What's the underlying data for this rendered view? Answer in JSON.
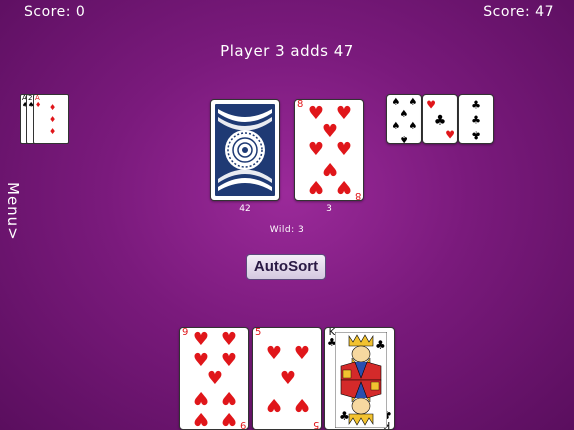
{
  "scores": {
    "left": "Score: 0",
    "right": "Score: 47"
  },
  "message": "Player 3 adds 47",
  "piles": {
    "draw_count": "42",
    "discard_count": "3"
  },
  "wild": "Wild: 3",
  "buttons": {
    "autosort": "AutoSort",
    "menu": "Menu>"
  },
  "colors": {
    "background": "#7a1a7c",
    "red_suit": "#e0161a",
    "black_suit": "#000000",
    "button_text": "#2a1a44"
  },
  "cards": {
    "opponent_left": [
      {
        "rank": "A",
        "suit": "spades"
      },
      {
        "rank": "2",
        "suit": "spades"
      },
      {
        "rank": "A",
        "suit": "diamonds",
        "pips": 3
      }
    ],
    "discard_top": {
      "rank": "8",
      "suit": "hearts"
    },
    "meld_right": [
      {
        "rank": "",
        "suit": "spades"
      },
      {
        "rank": "",
        "suit": "clubs"
      },
      {
        "rank": "",
        "suit": "clubs"
      }
    ],
    "player_hand": [
      {
        "rank": "9",
        "suit": "hearts"
      },
      {
        "rank": "5",
        "suit": "hearts"
      },
      {
        "rank": "K",
        "suit": "clubs"
      }
    ]
  },
  "icons": {
    "card_back": "card-back-pattern",
    "king": "king-face-art"
  }
}
